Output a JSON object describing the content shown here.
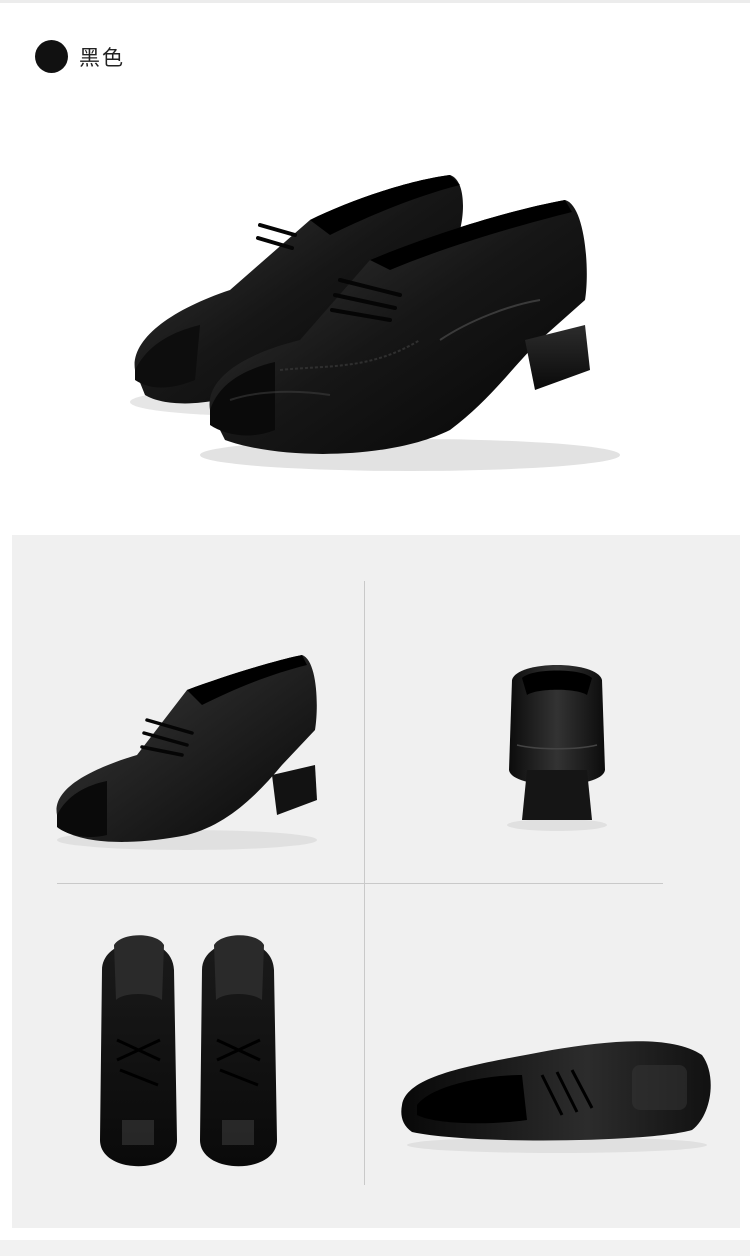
{
  "variant": {
    "swatch_color": "#111111",
    "label": "黑色"
  },
  "images": {
    "hero": "black-leather-lace-up-shoes-pair",
    "side": "shoe-side-view",
    "back": "shoe-back-view",
    "top": "shoes-top-view-pair",
    "angle": "shoe-angled-side-view"
  },
  "colors": {
    "shoe": "#141414",
    "panel_bg": "#f0f0f0",
    "divider": "#c9c9c9"
  }
}
